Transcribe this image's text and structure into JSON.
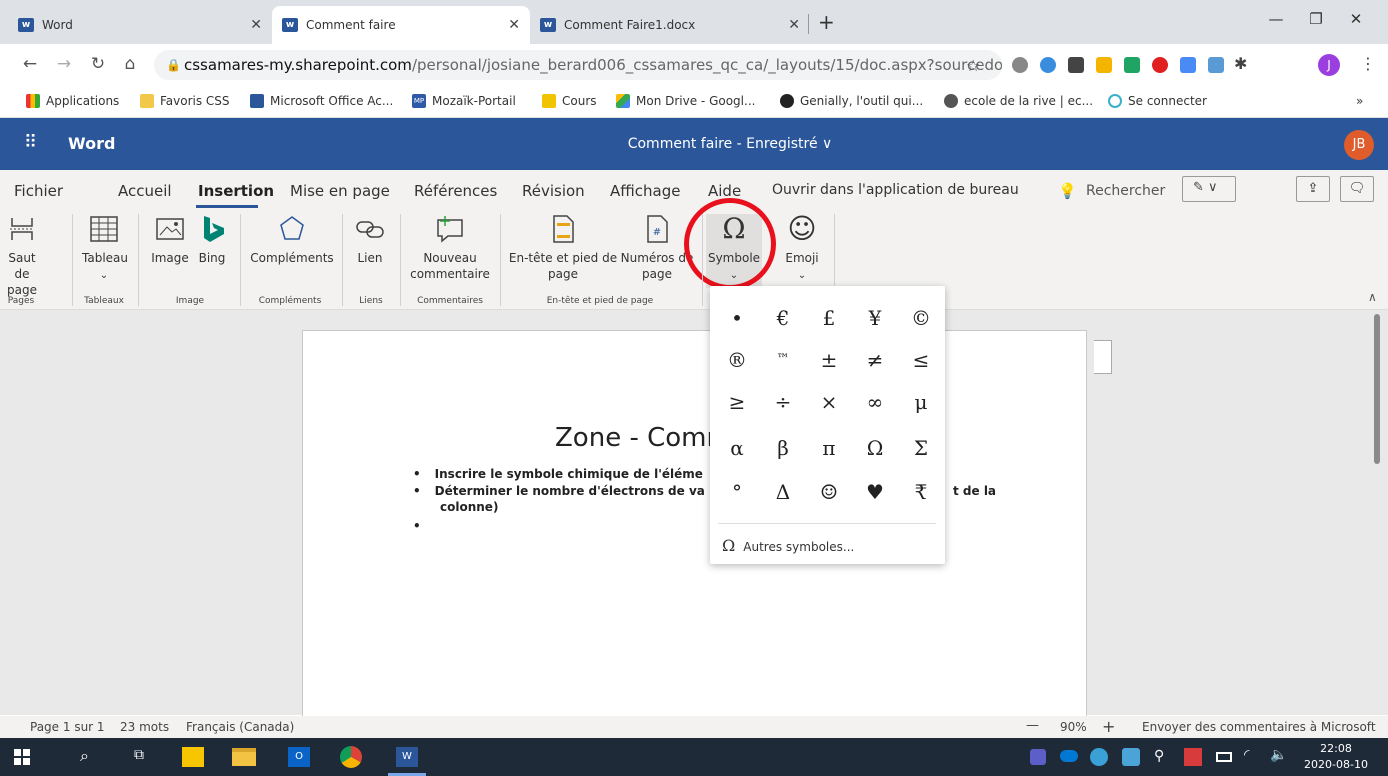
{
  "browser": {
    "tabs": [
      {
        "label": "Word",
        "active": false
      },
      {
        "label": "Comment faire",
        "active": true
      },
      {
        "label": "Comment Faire1.docx",
        "active": false
      }
    ],
    "new_tab": "+",
    "url_domain": "cssamares-my.sharepoint.com",
    "url_path": "/personal/josiane_berard006_cssamares_qc_ca/_layouts/15/doc.aspx?sourcedoc={...",
    "bookmarks": [
      "Applications",
      "Favoris CSS",
      "Microsoft Office Ac...",
      "Mozaïk-Portail",
      "Cours",
      "Mon Drive - Googl...",
      "Genially, l'outil qui...",
      "ecole de la rive | ec...",
      "Se connecter"
    ],
    "bookmarks_more": "»",
    "profile_initial": "J"
  },
  "word": {
    "app_name": "Word",
    "doc_title": "Comment faire - Enregistré ∨",
    "user_initials": "JB",
    "ribbon_tabs": [
      "Fichier",
      "Accueil",
      "Insertion",
      "Mise en page",
      "Références",
      "Révision",
      "Affichage",
      "Aide",
      "Ouvrir dans l'application de bureau"
    ],
    "search_label": "Rechercher",
    "buttons": {
      "saut_de_page": "Saut de page",
      "tableau": "Tableau",
      "image": "Image",
      "bing": "Bing",
      "complements": "Compléments",
      "lien": "Lien",
      "nouveau_commentaire": "Nouveau commentaire",
      "entete": "En-tête et pied de page",
      "numeros": "Numéros de page",
      "symbole": "Symbole",
      "emoji": "Emoji"
    },
    "groups": {
      "pages": "Pages",
      "tableaux": "Tableaux",
      "image": "Image",
      "complements": "Compléments",
      "liens": "Liens",
      "commentaires": "Commentaires",
      "entete": "En-tête et pied de page"
    }
  },
  "document": {
    "heading": "Zone - Comm",
    "bullets": [
      "Inscrire le symbole chimique de l'éléme",
      "Déterminer le nombre d'électrons de va",
      ""
    ],
    "bullet2_cont": "colonne)",
    "bullet2_tail": "t de la"
  },
  "symbol_menu": {
    "symbols": [
      "•",
      "€",
      "£",
      "¥",
      "©",
      "®",
      "™",
      "±",
      "≠",
      "≤",
      "≥",
      "÷",
      "×",
      "∞",
      "μ",
      "α",
      "β",
      "π",
      "Ω",
      "Σ",
      "°",
      "Δ",
      "☺",
      "♥",
      "₹"
    ],
    "more": "Autres symboles..."
  },
  "statusbar": {
    "page": "Page 1 sur 1",
    "words": "23 mots",
    "language": "Français (Canada)",
    "zoom_minus": "—",
    "zoom": "90%",
    "zoom_plus": "+",
    "feedback": "Envoyer des commentaires à Microsoft"
  },
  "taskbar": {
    "time": "22:08",
    "date": "2020-08-10"
  },
  "colors": {
    "word_blue": "#2b579a",
    "highlight_red": "#e8101c"
  }
}
